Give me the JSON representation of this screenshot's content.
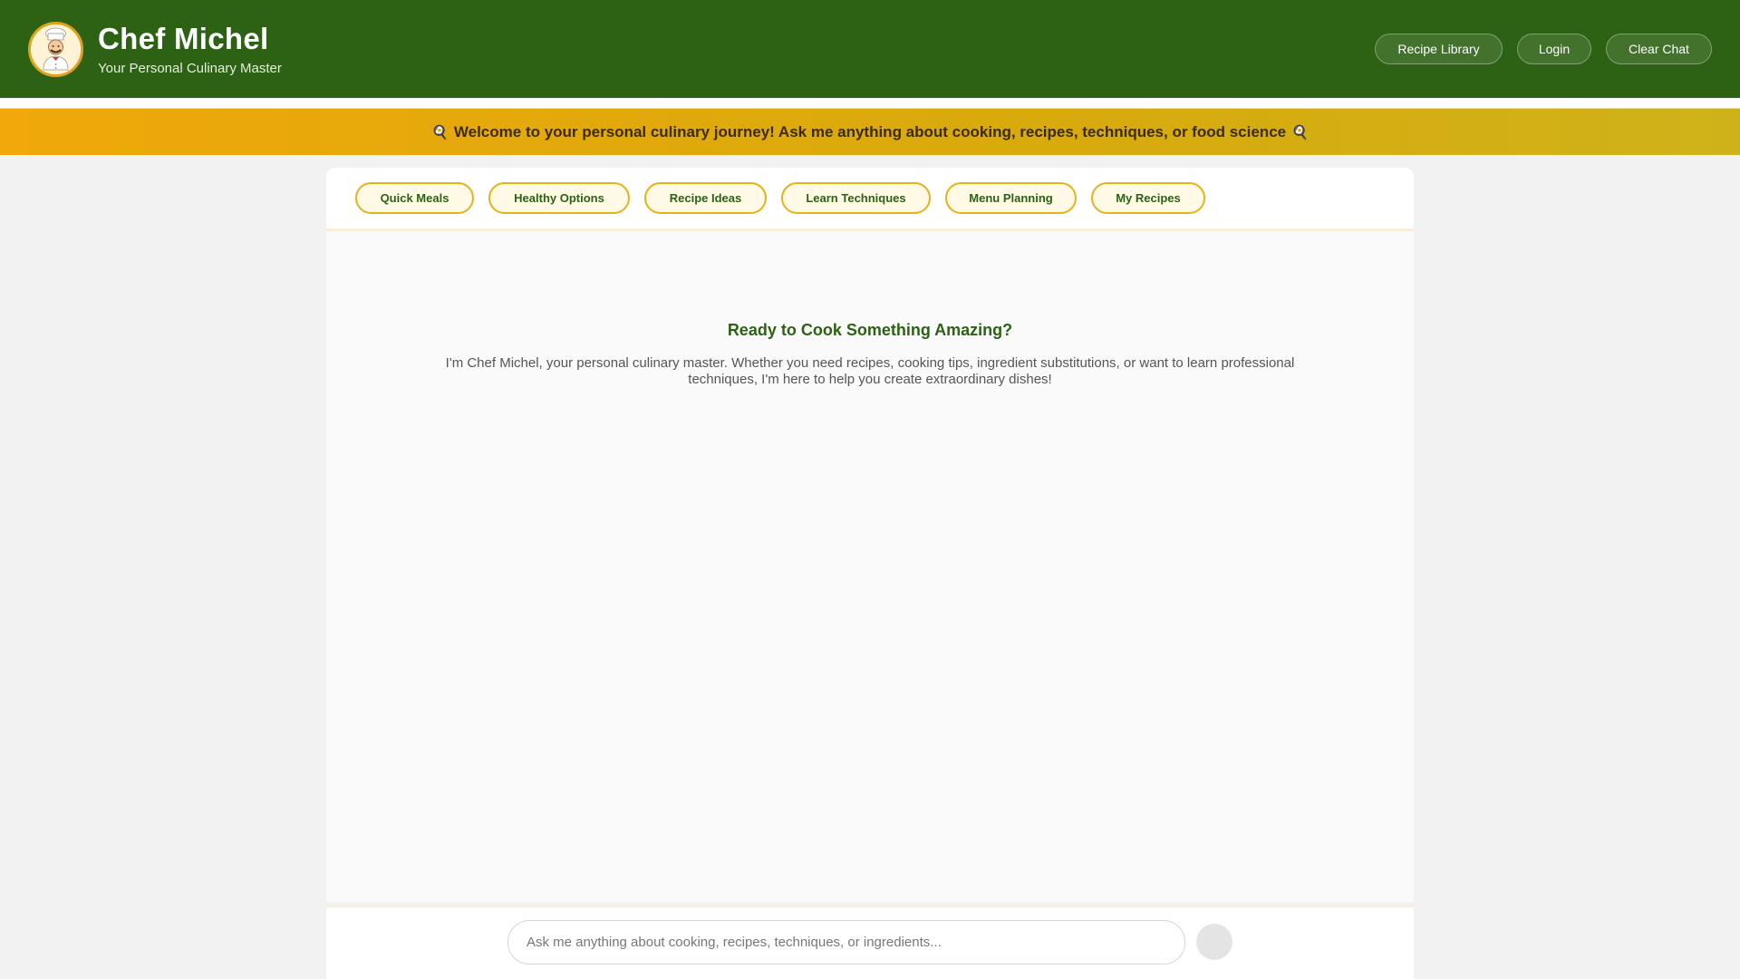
{
  "header": {
    "title": "Chef Michel",
    "subtitle": "Your Personal Culinary Master",
    "avatar_icon": "chef-icon",
    "buttons": {
      "recipe_library": "Recipe Library",
      "login": "Login",
      "clear_chat": "Clear Chat"
    },
    "colors": {
      "header_bg": "#2d6215",
      "accent": "#e6b21a"
    }
  },
  "banner": {
    "icon": "frying-pan-icon",
    "text": "Welcome to your personal culinary journey! Ask me anything about cooking, recipes, techniques, or food science"
  },
  "quick_actions": [
    {
      "label": "Quick Meals"
    },
    {
      "label": "Healthy Options"
    },
    {
      "label": "Recipe Ideas"
    },
    {
      "label": "Learn Techniques"
    },
    {
      "label": "Menu Planning"
    },
    {
      "label": "My Recipes"
    }
  ],
  "welcome": {
    "title": "Ready to Cook Something Amazing?",
    "text": "I'm Chef Michel, your personal culinary master. Whether you need recipes, cooking tips, ingredient substitutions, or want to learn professional techniques, I'm here to help you create extraordinary dishes!"
  },
  "chat": {
    "placeholder": "Ask me anything about cooking, recipes, techniques, or ingredients...",
    "send_icon": "send-icon"
  }
}
